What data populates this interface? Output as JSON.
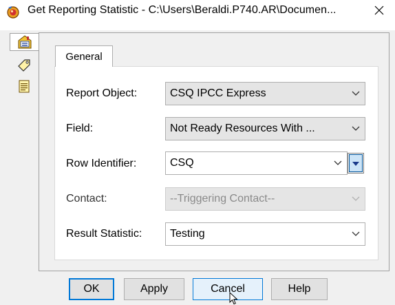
{
  "window": {
    "title": "Get Reporting Statistic - C:\\Users\\Beraldi.P740.AR\\Documen...",
    "icon": "script-editor-icon",
    "close_glyph": "✕"
  },
  "side_tabs": [
    {
      "icon": "house-list-icon",
      "selected": true
    },
    {
      "icon": "tag-icon",
      "selected": false
    },
    {
      "icon": "notepad-icon",
      "selected": false
    }
  ],
  "tab": {
    "label": "General"
  },
  "fields": {
    "report_object": {
      "label": "Report Object:",
      "value": "CSQ IPCC Express"
    },
    "field": {
      "label": "Field:",
      "value": "Not Ready Resources With ..."
    },
    "row_identifier": {
      "label": "Row Identifier:",
      "value": "CSQ"
    },
    "contact": {
      "label": "Contact:",
      "value": "--Triggering Contact--"
    },
    "result_statistic": {
      "label": "Result Statistic:",
      "value": "Testing"
    }
  },
  "buttons": {
    "ok": "OK",
    "apply": "Apply",
    "cancel": "Cancel",
    "help": "Help"
  },
  "colors": {
    "accent": "#0078d7",
    "face": "#f0f0f0",
    "button": "#e1e1e1"
  }
}
